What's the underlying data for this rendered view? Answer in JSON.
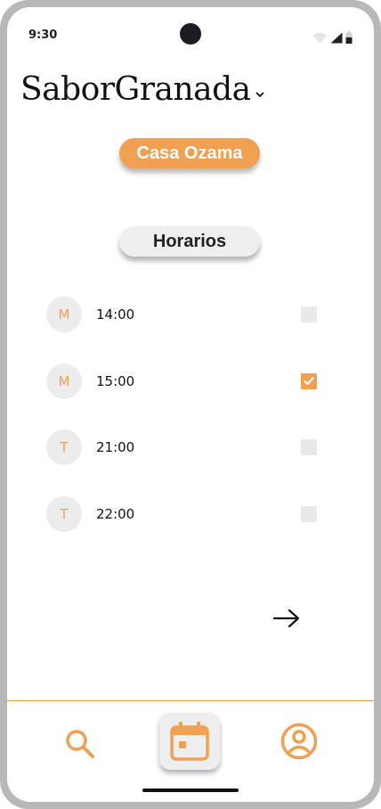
{
  "status_bar": {
    "time": "9:30"
  },
  "header": {
    "app_title": "SaborGranada",
    "restaurant": "Casa Ozama",
    "section": "Horarios"
  },
  "schedule": {
    "items": [
      {
        "shift": "M",
        "time": "14:00",
        "checked": false
      },
      {
        "shift": "M",
        "time": "15:00",
        "checked": true
      },
      {
        "shift": "T",
        "time": "21:00",
        "checked": false
      },
      {
        "shift": "T",
        "time": "22:00",
        "checked": false
      }
    ]
  },
  "nav": {
    "items": [
      {
        "icon": "search-icon",
        "active": false
      },
      {
        "icon": "calendar-icon",
        "active": true
      },
      {
        "icon": "profile-icon",
        "active": false
      }
    ]
  },
  "colors": {
    "accent": "#f0a050",
    "pill_gray": "#efefef",
    "badge_gray": "#ececec"
  }
}
